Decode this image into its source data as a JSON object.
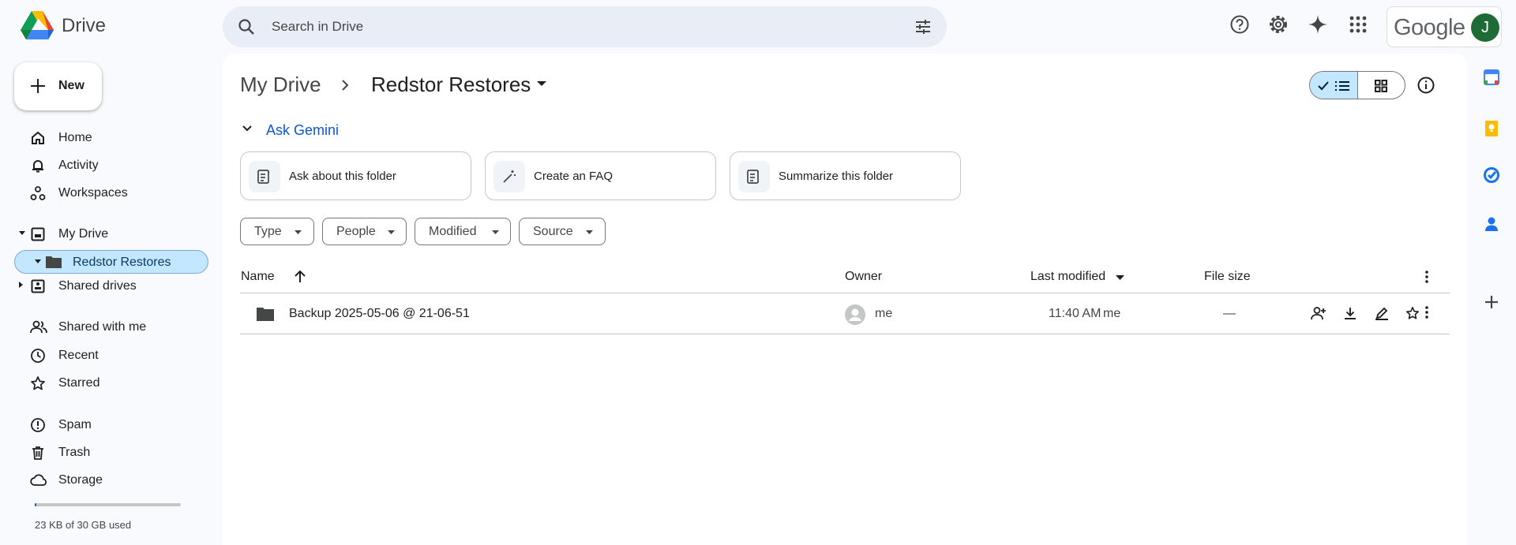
{
  "app": {
    "name": "Drive"
  },
  "search": {
    "placeholder": "Search in Drive"
  },
  "account": {
    "brand": "Google",
    "avatar_letter": "J",
    "avatar_color": "#1e6b35"
  },
  "sidebar": {
    "new_label": "New",
    "items": [
      {
        "label": "Home",
        "icon": "home-icon"
      },
      {
        "label": "Activity",
        "icon": "bell-icon"
      },
      {
        "label": "Workspaces",
        "icon": "workspaces-icon"
      },
      {
        "label": "My Drive",
        "icon": "my-drive-icon"
      },
      {
        "label": "Redstor Restores",
        "icon": "folder-icon"
      },
      {
        "label": "Shared drives",
        "icon": "shared-drives-icon"
      },
      {
        "label": "Shared with me",
        "icon": "people-icon"
      },
      {
        "label": "Recent",
        "icon": "clock-icon"
      },
      {
        "label": "Starred",
        "icon": "star-icon"
      },
      {
        "label": "Spam",
        "icon": "spam-icon"
      },
      {
        "label": "Trash",
        "icon": "trash-icon"
      },
      {
        "label": "Storage",
        "icon": "cloud-icon"
      }
    ],
    "storage_text": "23 KB of 30 GB used",
    "storage_used_fraction": 0.001
  },
  "breadcrumb": {
    "root": "My Drive",
    "current": "Redstor Restores"
  },
  "gemini": {
    "label": "Ask Gemini",
    "cards": [
      "Ask about this folder",
      "Create an FAQ",
      "Summarize this folder"
    ]
  },
  "filters": [
    "Type",
    "People",
    "Modified",
    "Source"
  ],
  "table": {
    "columns": {
      "name": "Name",
      "owner": "Owner",
      "modified": "Last modified",
      "size": "File size"
    },
    "rows": [
      {
        "name": "Backup 2025-05-06 @ 21-06-51",
        "owner": "me",
        "modified": "11:40 AM",
        "modified_by": "me",
        "size": "—"
      }
    ]
  },
  "colors": {
    "accent": "#0b57d0",
    "selected": "#c2e7ff",
    "search_bg": "#e9eef6",
    "page_bg": "#f8fafd"
  }
}
